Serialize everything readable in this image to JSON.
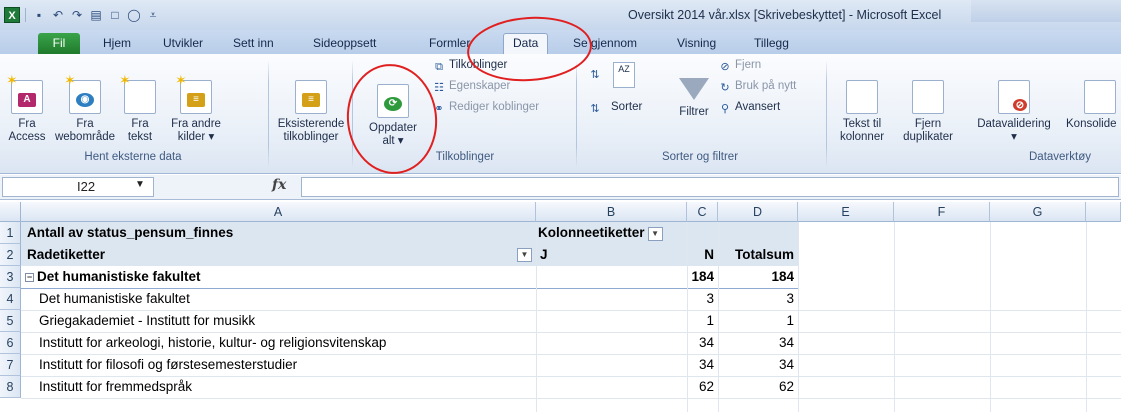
{
  "window": {
    "title": "Oversikt 2014 vår.xlsx  [Skrivebeskyttet]  -  Microsoft Excel"
  },
  "tabs": [
    "Fil",
    "Hjem",
    "Utvikler",
    "Sett inn",
    "Sideoppsett",
    "Formler",
    "Data",
    "Se gjennom",
    "Visning",
    "Tillegg"
  ],
  "active_tab": "Data",
  "ribbon": {
    "get_external": {
      "access_l1": "Fra",
      "access_l2": "Access",
      "web_l1": "Fra",
      "web_l2": "webområde",
      "text_l1": "Fra",
      "text_l2": "tekst",
      "other_l1": "Fra andre",
      "other_l2": "kilder ▾",
      "group_label": "Hent eksterne data"
    },
    "existing": {
      "l1": "Eksisterende",
      "l2": "tilkoblinger"
    },
    "connections": {
      "refresh_l1": "Oppdater",
      "refresh_l2": "alt ▾",
      "connections": "Tilkoblinger",
      "properties": "Egenskaper",
      "edit_links": "Rediger koblinger",
      "group_label": "Tilkoblinger"
    },
    "sort_filter": {
      "sort": "Sorter",
      "filter": "Filtrer",
      "clear": "Fjern",
      "reapply": "Bruk på nytt",
      "advanced": "Avansert",
      "group_label": "Sorter og filtrer"
    },
    "tools": {
      "text_to_col_l1": "Tekst til",
      "text_to_col_l2": "kolonner",
      "remove_dup_l1": "Fjern",
      "remove_dup_l2": "duplikater",
      "validation": "Datavalidering",
      "validation_arrow": "▾",
      "consolidate": "Konsolide",
      "group_label": "Dataverktøy"
    }
  },
  "formula_bar": {
    "name_box": "I22",
    "fx": "fx",
    "formula": ""
  },
  "columns": [
    "A",
    "B",
    "C",
    "D",
    "E",
    "F",
    "G"
  ],
  "rows": [
    "1",
    "2",
    "3",
    "4",
    "5",
    "6",
    "7",
    "8"
  ],
  "pivot": {
    "r1": {
      "a": "Antall av status_pensum_finnes",
      "b": "Kolonneetiketter"
    },
    "r2": {
      "a": "Radetiketter",
      "b": "J",
      "c": "N",
      "d": "Totalsum"
    },
    "r3": {
      "a": "Det humanistiske fakultet",
      "c": "184",
      "d": "184"
    },
    "items": [
      {
        "a": "Det humanistiske fakultet",
        "c": "3",
        "d": "3"
      },
      {
        "a": "Griegakademiet - Institutt for musikk",
        "c": "1",
        "d": "1"
      },
      {
        "a": "Institutt for arkeologi, historie, kultur- og religionsvitenskap",
        "c": "34",
        "d": "34"
      },
      {
        "a": "Institutt for filosofi og førstesemesterstudier",
        "c": "34",
        "d": "34"
      },
      {
        "a": "Institutt for fremmedspråk",
        "c": "62",
        "d": "62"
      }
    ]
  },
  "colors": {
    "excel_green": "#1f7a3a",
    "pivot_header": "#dce6f1",
    "annotation_red": "#e02020"
  }
}
